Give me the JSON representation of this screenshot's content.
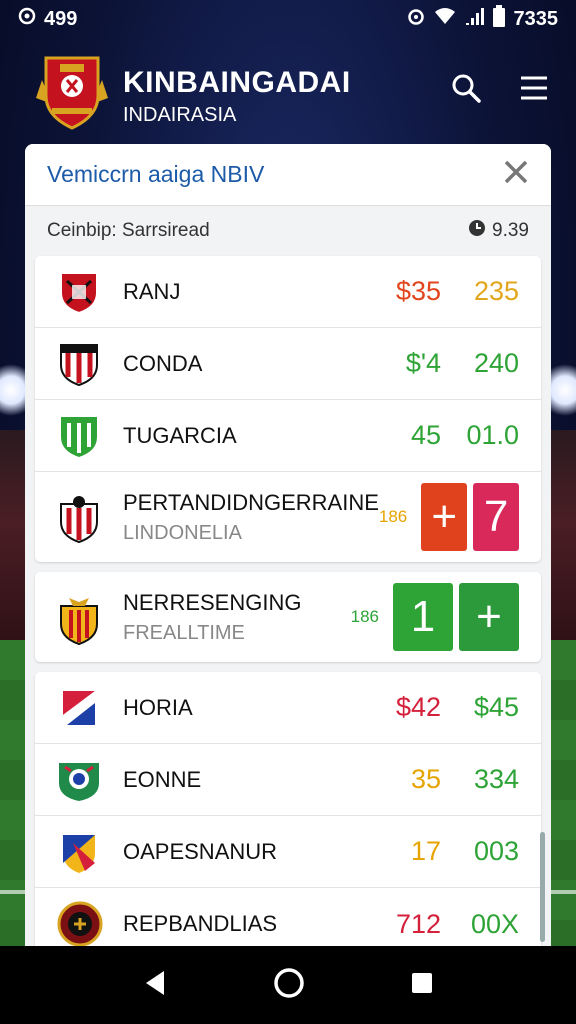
{
  "status": {
    "left": "499",
    "right": "7335"
  },
  "brand": {
    "title": "KINBAINGADAI",
    "subtitle": "INDAIRASIA"
  },
  "panel": {
    "title": "Vemiccrn aaiga NBIV",
    "subtitle": "Ceinbip: Sarrsiread",
    "time": "9.39"
  },
  "groups": [
    {
      "rows": [
        {
          "name": "RANJ",
          "o1": "$35",
          "o2": "235",
          "c1": "#e1451c",
          "c2": "#e1a61c",
          "badge": "red-shield-icon"
        },
        {
          "name": "CONDA",
          "o1": "$'4",
          "o2": "240",
          "c1": "#2ea336",
          "c2": "#2ea336",
          "badge": "red-stripe-shield-icon"
        },
        {
          "name": "TUGARCIA",
          "o1": "45",
          "o2": "01.0",
          "c1": "#2ea336",
          "c2": "#2ea336",
          "badge": "green-shield-icon"
        },
        {
          "name": "PERTANDIDNGERRAINE",
          "sub": "LINDONELIA",
          "small": "186",
          "tile1": "+",
          "tile2": "7",
          "tileColor1": "#e0421e",
          "tileColor2": "#d9285a",
          "smallColor": "#e5a400",
          "badge": "club-shield-icon"
        }
      ]
    },
    {
      "rows": [
        {
          "name": "NERRESENGING",
          "sub": "FREALLTIME",
          "small": "186",
          "tile1": "1",
          "tile2": "+",
          "tileColor1": "#2ea336",
          "tileColor2": "#2c9a3a",
          "smallColor": "#2ea336",
          "badge": "yellow-crest-icon"
        }
      ]
    },
    {
      "rows": [
        {
          "name": "HORIA",
          "o1": "$42",
          "o2": "$45",
          "c1": "#d4203a",
          "c2": "#2ea336",
          "badge": "flag-badge-icon"
        },
        {
          "name": "EONNE",
          "o1": "35",
          "o2": "334",
          "c1": "#e5a400",
          "c2": "#2ea336",
          "badge": "green-crest-icon"
        },
        {
          "name": "OAPESNANUR",
          "o1": "17",
          "o2": "003",
          "c1": "#e5a400",
          "c2": "#2ea336",
          "badge": "tricolor-badge-icon"
        },
        {
          "name": "REPBANDLIAS",
          "o1": "712",
          "o2": "00X",
          "c1": "#d4203a",
          "c2": "#2ea336",
          "badge": "round-crest-icon"
        }
      ]
    }
  ]
}
